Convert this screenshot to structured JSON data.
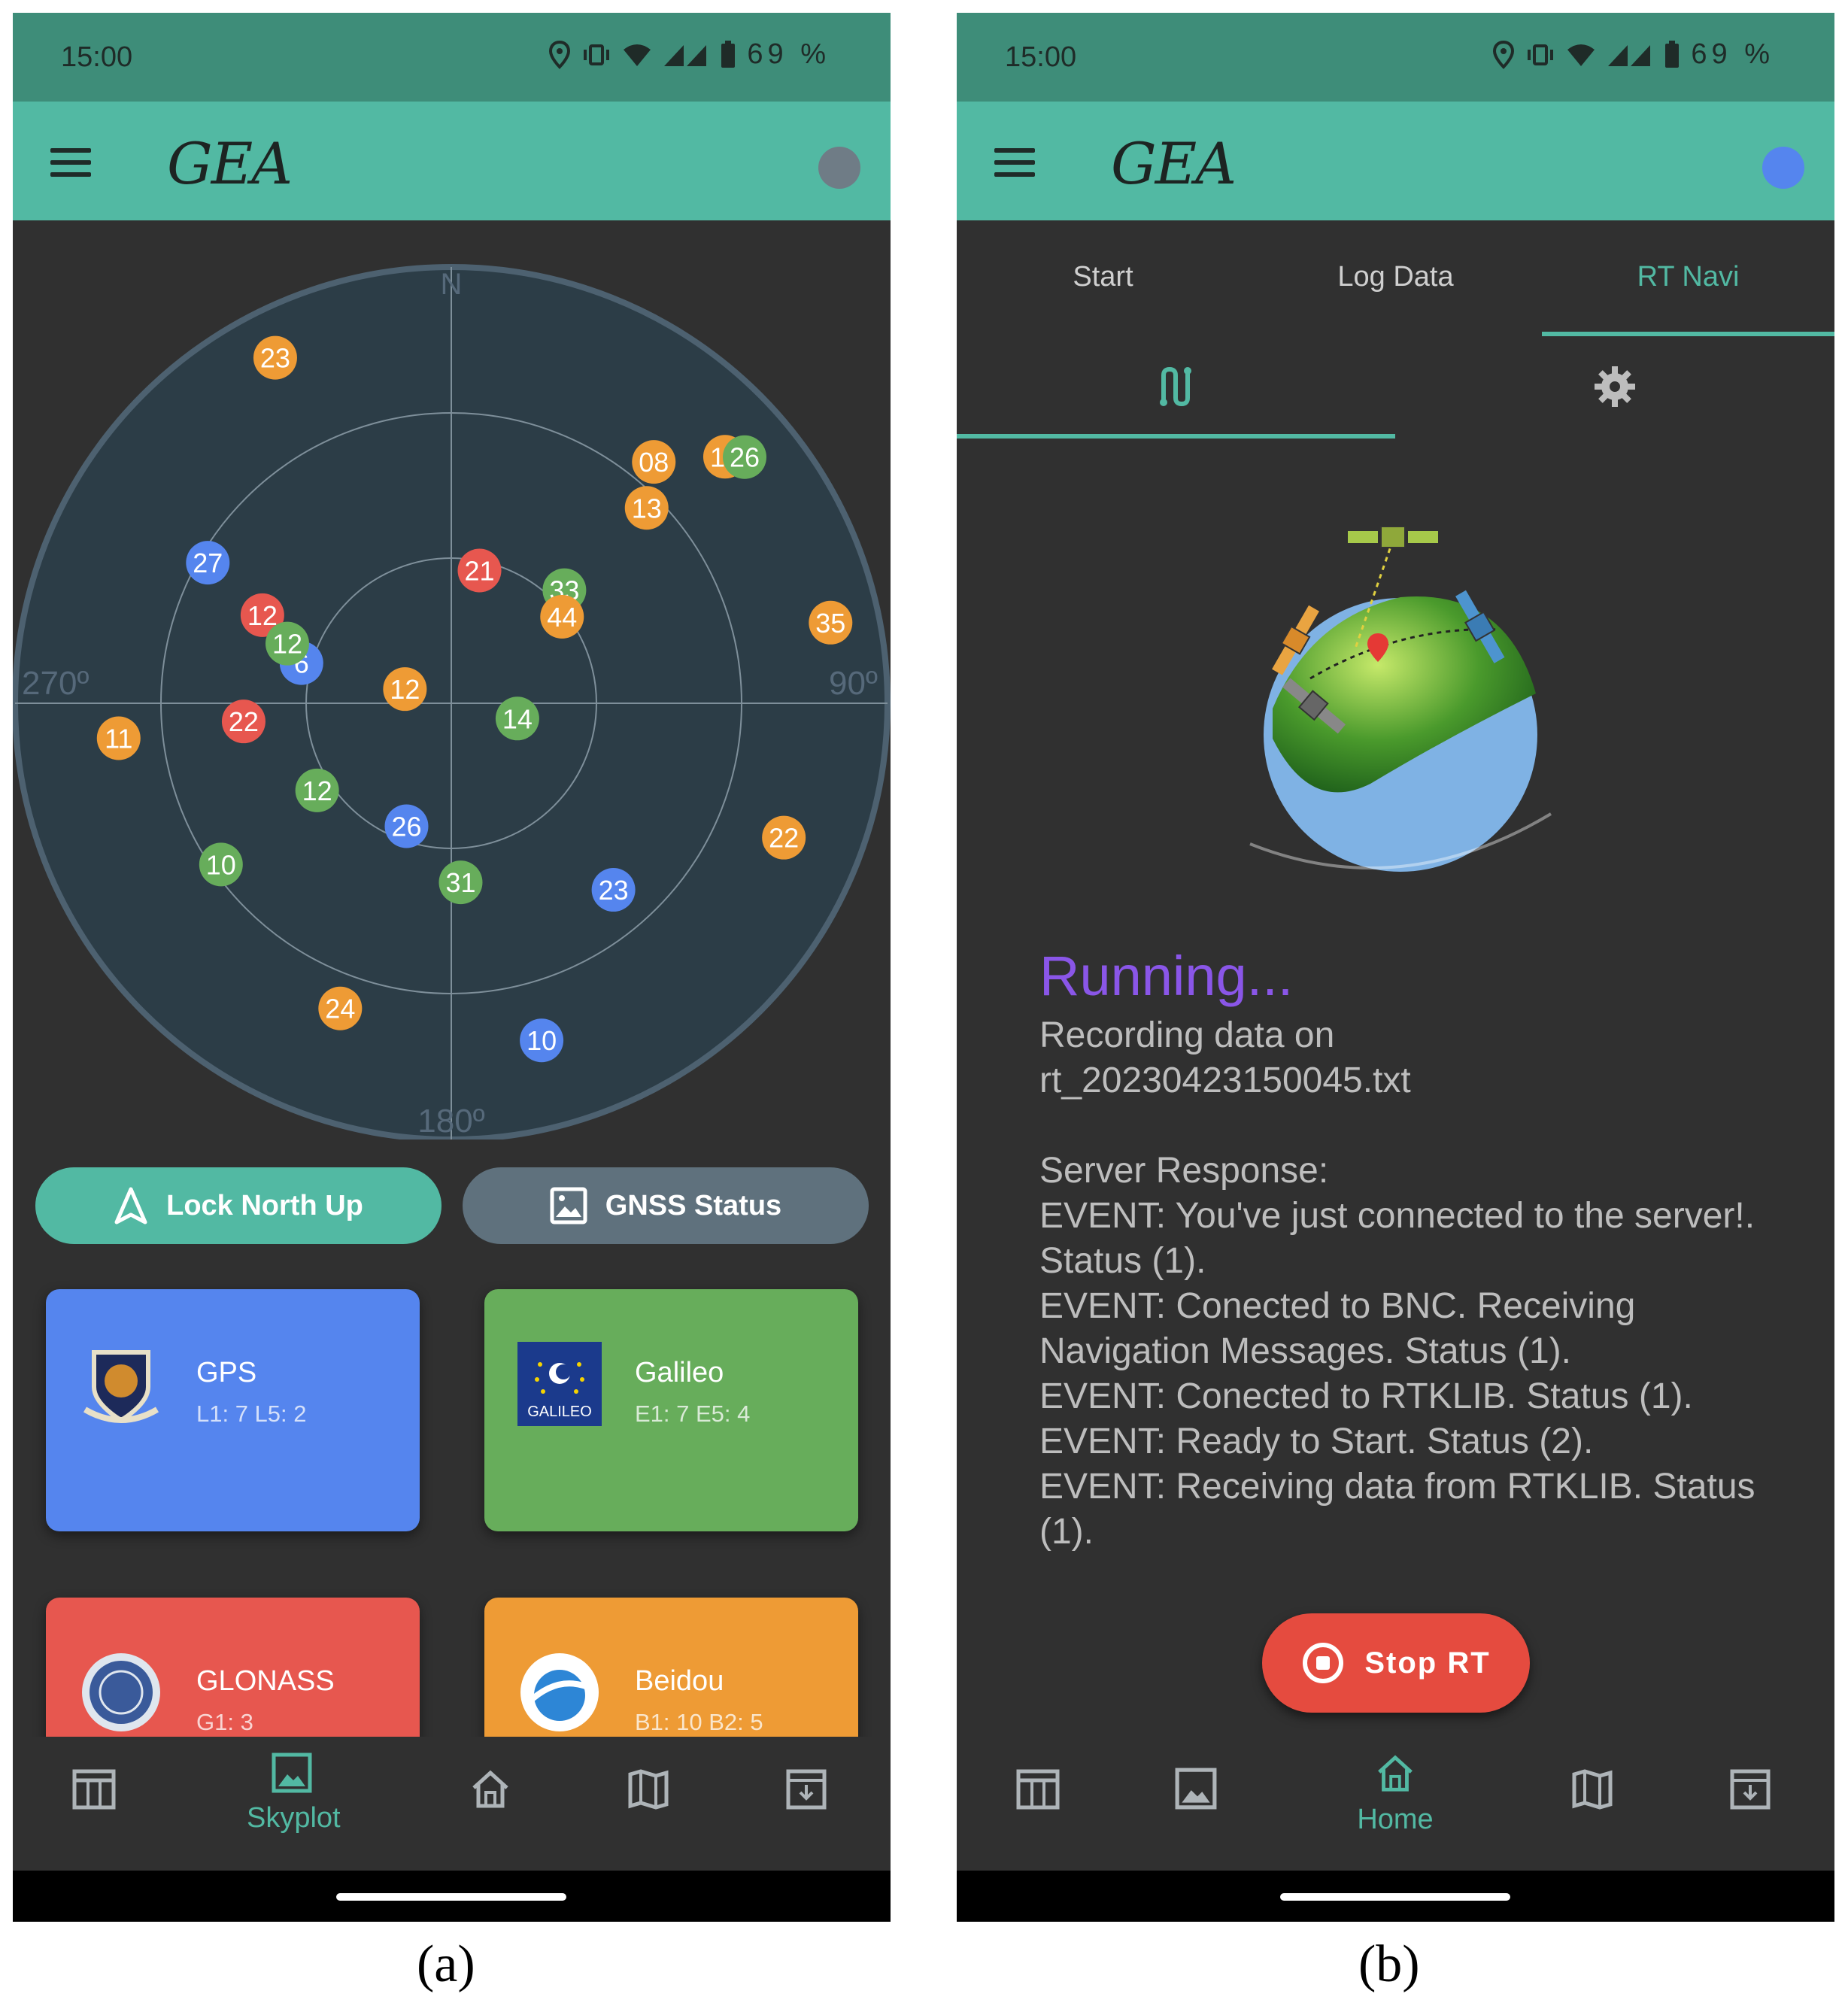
{
  "colors": {
    "accent": "#52b9a3",
    "statusbar": "#3e8d79",
    "background": "#303030",
    "gps": "#5585ee",
    "galileo": "#67ad5b",
    "glonass": "#e7574f",
    "beidou": "#ee9b35",
    "running": "#8a56e8",
    "stop": "#e54b3f"
  },
  "screen_a": {
    "status_time": "15:00",
    "battery": "69 %",
    "app_logo": "GEA",
    "skyplot": {
      "north_label": "N",
      "east_label": "90º",
      "south_label": "180º",
      "west_label": "270º",
      "satellites": [
        {
          "id": "23",
          "az": 333,
          "el": 10,
          "color": "orange"
        },
        {
          "id": "08",
          "az": 40,
          "el": 25,
          "color": "orange"
        },
        {
          "id": "19",
          "az": 48,
          "el": 14,
          "color": "orange"
        },
        {
          "id": "26",
          "az": 50,
          "el": 11,
          "color": "green"
        },
        {
          "id": "13",
          "az": 45,
          "el": 33,
          "color": "orange"
        },
        {
          "id": "35",
          "az": 78,
          "el": 10,
          "color": "orange"
        },
        {
          "id": "21",
          "az": 12,
          "el": 62,
          "color": "red"
        },
        {
          "id": "33",
          "az": 45,
          "el": 57,
          "color": "green"
        },
        {
          "id": "44",
          "az": 52,
          "el": 61,
          "color": "orange"
        },
        {
          "id": "14",
          "az": 103,
          "el": 76,
          "color": "green"
        },
        {
          "id": "27",
          "az": 300,
          "el": 32,
          "color": "blue"
        },
        {
          "id": "12",
          "az": 295,
          "el": 47,
          "color": "red"
        },
        {
          "id": "6",
          "az": 285,
          "el": 58,
          "color": "blue"
        },
        {
          "id": "12",
          "az": 290,
          "el": 54,
          "color": "green"
        },
        {
          "id": "22",
          "az": 265,
          "el": 47,
          "color": "red"
        },
        {
          "id": "12",
          "az": 287,
          "el": 80,
          "color": "orange"
        },
        {
          "id": "11",
          "az": 264,
          "el": 21,
          "color": "orange"
        },
        {
          "id": "22",
          "az": 112,
          "el": 16,
          "color": "orange"
        },
        {
          "id": "12",
          "az": 237,
          "el": 57,
          "color": "green"
        },
        {
          "id": "26",
          "az": 200,
          "el": 63,
          "color": "blue"
        },
        {
          "id": "31",
          "az": 177,
          "el": 53,
          "color": "green"
        },
        {
          "id": "23",
          "az": 139,
          "el": 39,
          "color": "blue"
        },
        {
          "id": "10",
          "az": 235,
          "el": 32,
          "color": "green"
        },
        {
          "id": "24",
          "az": 200,
          "el": 23,
          "color": "orange"
        },
        {
          "id": "10",
          "az": 165,
          "el": 18,
          "color": "blue"
        }
      ]
    },
    "buttons": {
      "lock_north": "Lock North Up",
      "gnss_status": "GNSS Status"
    },
    "constellations": [
      {
        "name": "GPS",
        "signals": "L1: 7 L5: 2",
        "logo_text": ""
      },
      {
        "name": "Galileo",
        "signals": "E1: 7 E5: 4",
        "logo_text": "GALILEO"
      },
      {
        "name": "GLONASS",
        "signals": "G1: 3",
        "logo_text": ""
      },
      {
        "name": "Beidou",
        "signals": "B1: 10 B2: 5",
        "logo_text": ""
      }
    ],
    "nav": {
      "active_label": "Skyplot"
    },
    "caption": "(a)"
  },
  "screen_b": {
    "status_time": "15:00",
    "battery": "69 %",
    "app_logo": "GEA",
    "tabs": [
      "Start",
      "Log Data",
      "RT Navi"
    ],
    "active_tab": "RT Navi",
    "status_title": "Running...",
    "status_text": "Recording data on\nrt_20230423150045.txt\n\nServer Response:\nEVENT: You've just connected to the server!. Status (1).\nEVENT: Conected to BNC. Receiving Navigation Messages. Status (1).\nEVENT: Conected to RTKLIB. Status (1).\nEVENT: Ready to Start. Status (2).\nEVENT: Receiving data from RTKLIB. Status (1).",
    "stop_button": "Stop RT",
    "nav": {
      "active_label": "Home"
    },
    "caption": "(b)"
  }
}
